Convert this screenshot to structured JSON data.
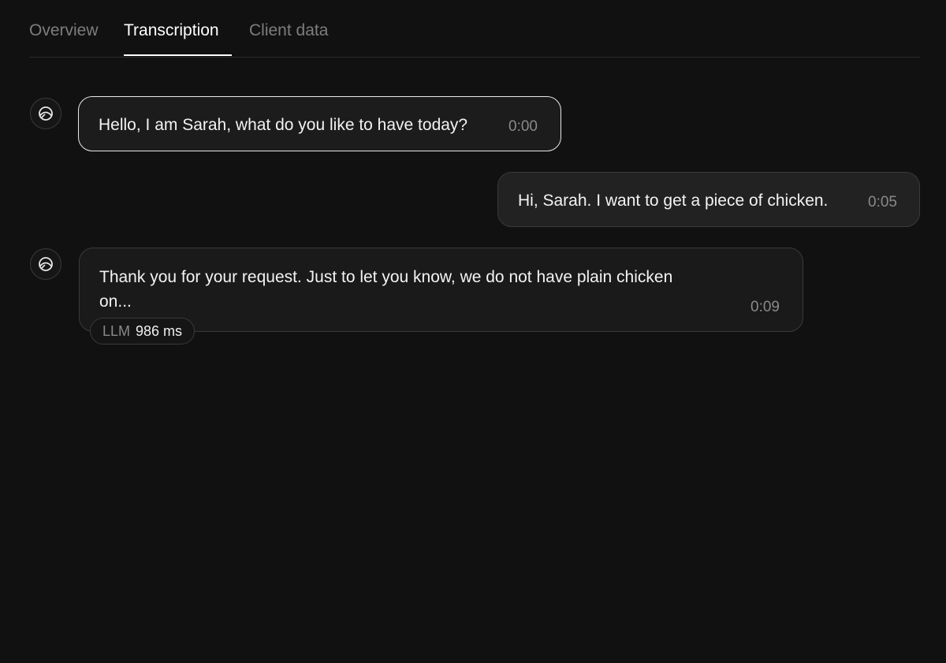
{
  "tabs": [
    {
      "label": "Overview"
    },
    {
      "label": "Transcription"
    },
    {
      "label": "Client data"
    }
  ],
  "active_tab": "Transcription",
  "messages": [
    {
      "sender": "agent",
      "icon": "agent-avatar-icon",
      "text": "Hello, I am Sarah, what do you like to have today?",
      "time": "0:00",
      "highlighted": true
    },
    {
      "sender": "user",
      "text": "Hi, Sarah. I want to get a piece of chicken.",
      "time": "0:05"
    },
    {
      "sender": "agent",
      "icon": "agent-avatar-icon",
      "text_line1": "Thank you for your request. Just to let you know, we do not have plain chicken",
      "text_line2": "on...",
      "time": "0:09",
      "badge": {
        "label": "LLM",
        "value": "986 ms"
      }
    }
  ],
  "colors": {
    "background": "#111111",
    "bubble_border": "#3a3a3a",
    "highlight_border": "#e8e8e8",
    "muted_text": "#8a8a8a"
  }
}
